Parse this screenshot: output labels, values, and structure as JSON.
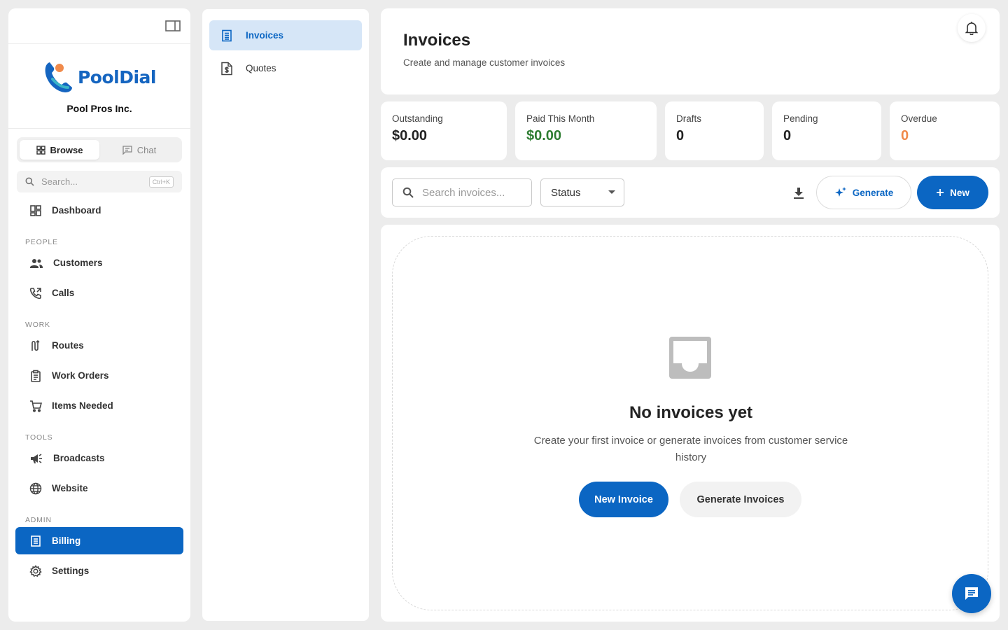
{
  "brand": {
    "logo_text": "PoolDial",
    "company": "Pool Pros Inc."
  },
  "mode_toggle": {
    "browse": "Browse",
    "chat": "Chat"
  },
  "sidebar_search": {
    "placeholder": "Search...",
    "shortcut": "Ctrl+K"
  },
  "nav": {
    "dashboard": "Dashboard",
    "sections": {
      "people": "PEOPLE",
      "work": "WORK",
      "tools": "TOOLS",
      "admin": "ADMIN"
    },
    "customers": "Customers",
    "calls": "Calls",
    "routes": "Routes",
    "work_orders": "Work Orders",
    "items_needed": "Items Needed",
    "broadcasts": "Broadcasts",
    "website": "Website",
    "billing": "Billing",
    "settings": "Settings"
  },
  "subnav": {
    "invoices": "Invoices",
    "quotes": "Quotes"
  },
  "header": {
    "title": "Invoices",
    "subtitle": "Create and manage customer invoices"
  },
  "stats": {
    "outstanding": {
      "label": "Outstanding",
      "value": "$0.00"
    },
    "paid": {
      "label": "Paid This Month",
      "value": "$0.00",
      "color": "#2e7d32"
    },
    "drafts": {
      "label": "Drafts",
      "value": "0"
    },
    "pending": {
      "label": "Pending",
      "value": "0"
    },
    "overdue": {
      "label": "Overdue",
      "value": "0",
      "color": "#f08a4b"
    }
  },
  "toolbar": {
    "search_placeholder": "Search invoices...",
    "status_label": "Status",
    "generate_label": "Generate",
    "new_label": "New"
  },
  "empty_state": {
    "title": "No invoices yet",
    "description": "Create your first invoice or generate invoices from customer service history",
    "new_invoice_label": "New Invoice",
    "generate_invoices_label": "Generate Invoices"
  },
  "colors": {
    "accent": "#0b66c3",
    "active_sub_bg": "#d6e6f7"
  }
}
